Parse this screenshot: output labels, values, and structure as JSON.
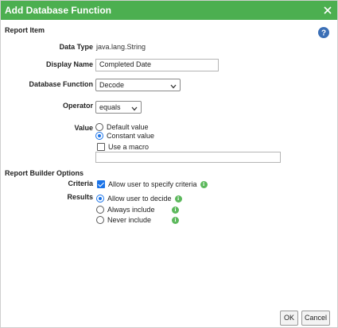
{
  "dialog": {
    "title": "Add Database Function",
    "close_icon": "close-icon",
    "help_icon": "help-icon"
  },
  "report_item": {
    "heading": "Report Item",
    "data_type_label": "Data Type",
    "data_type_value": "java.lang.String",
    "display_name_label": "Display Name",
    "display_name_value": "Completed Date",
    "database_function_label": "Database Function",
    "database_function_value": "Decode",
    "operator_label": "Operator",
    "operator_value": "equals",
    "value_label": "Value",
    "value_options": [
      {
        "label": "Default value",
        "selected": false
      },
      {
        "label": "Constant value",
        "selected": true
      }
    ],
    "use_macro_label": "Use a macro",
    "use_macro_checked": false,
    "constant_value_text": ""
  },
  "report_builder_options": {
    "heading": "Report Builder Options",
    "criteria_label": "Criteria",
    "criteria_option": "Allow user to specify criteria",
    "criteria_checked": true,
    "results_label": "Results",
    "results_options": [
      {
        "label": "Allow user to decide",
        "selected": true
      },
      {
        "label": "Always include",
        "selected": false
      },
      {
        "label": "Never include",
        "selected": false
      }
    ]
  },
  "footer": {
    "ok_label": "OK",
    "cancel_label": "Cancel"
  },
  "colors": {
    "titlebar": "#4caf50",
    "accent": "#1a73e8",
    "info": "#5cb85c"
  }
}
